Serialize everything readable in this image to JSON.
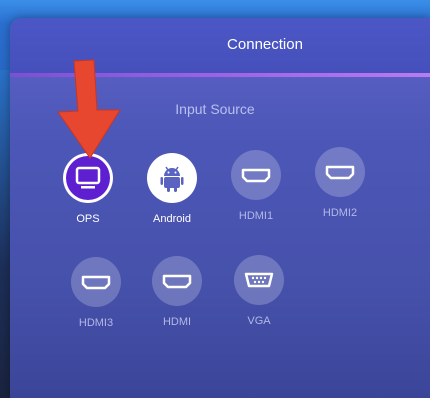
{
  "window": {
    "title": "Connection"
  },
  "section": {
    "title": "Input Source"
  },
  "sources": [
    {
      "label": "OPS",
      "icon": "monitor-icon",
      "selected": true
    },
    {
      "label": "Android",
      "icon": "android-icon",
      "selected": false
    },
    {
      "label": "HDMI1",
      "icon": "hdmi-icon",
      "selected": false
    },
    {
      "label": "HDMI2",
      "icon": "hdmi-icon",
      "selected": false
    },
    {
      "label": "HDMI3",
      "icon": "hdmi-icon",
      "selected": false
    },
    {
      "label": "HDMI",
      "icon": "hdmi-icon",
      "selected": false
    },
    {
      "label": "VGA",
      "icon": "vga-icon",
      "selected": false
    }
  ],
  "colors": {
    "panel": "#4d57b8",
    "header_accent": "#9d63e6",
    "selected": "#5e1fd0",
    "arrow": "#e8472f"
  }
}
